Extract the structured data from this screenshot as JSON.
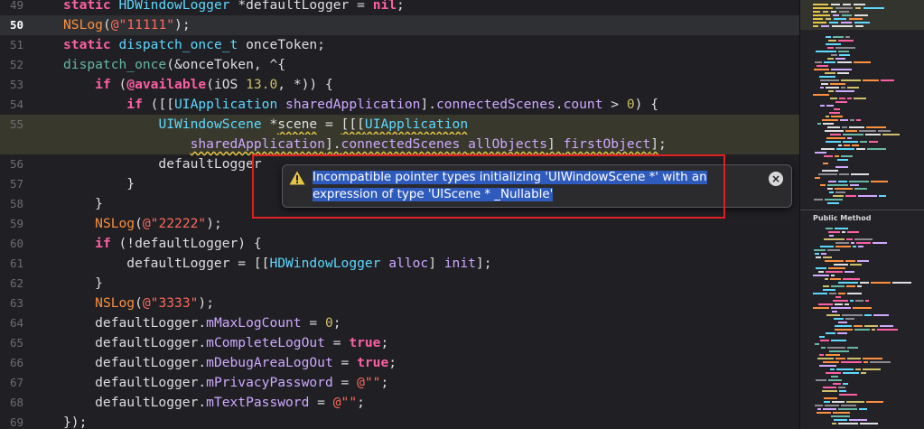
{
  "editor": {
    "lines": [
      {
        "no": "49",
        "segs": [
          [
            "kw",
            "static "
          ],
          [
            "ty",
            "HDWindowLogger "
          ],
          [
            "pl",
            "*defaultLogger = "
          ],
          [
            "kw",
            "nil"
          ],
          [
            "pl",
            ";"
          ]
        ]
      },
      {
        "no": "50",
        "current": true,
        "segs": [
          [
            "mac",
            "NSLog"
          ],
          [
            "pl",
            "("
          ],
          [
            "str",
            "@\"11111\""
          ],
          [
            "pl",
            ");"
          ]
        ]
      },
      {
        "no": "51",
        "segs": [
          [
            "kw",
            "static "
          ],
          [
            "ty",
            "dispatch_once_t "
          ],
          [
            "pl",
            "onceToken;"
          ]
        ]
      },
      {
        "no": "52",
        "segs": [
          [
            "fn",
            "dispatch_once"
          ],
          [
            "pl",
            "(&onceToken, ^{"
          ]
        ]
      },
      {
        "no": "53",
        "segs": [
          [
            "pl",
            "    "
          ],
          [
            "kw",
            "if "
          ],
          [
            "pl",
            "("
          ],
          [
            "kw",
            "@available"
          ],
          [
            "pl",
            "(iOS "
          ],
          [
            "num",
            "13.0"
          ],
          [
            "pl",
            ", *)) {"
          ]
        ]
      },
      {
        "no": "54",
        "segs": [
          [
            "pl",
            "        "
          ],
          [
            "kw",
            "if "
          ],
          [
            "pl",
            "([["
          ],
          [
            "ty",
            "UIApplication "
          ],
          [
            "pt",
            "sharedApplication"
          ],
          [
            "pl",
            "]."
          ],
          [
            "pt",
            "connectedScenes"
          ],
          [
            "pl",
            "."
          ],
          [
            "pt",
            "count"
          ],
          [
            "pl",
            " > "
          ],
          [
            "num",
            "0"
          ],
          [
            "pl",
            ") {"
          ]
        ]
      },
      {
        "no": "55",
        "warn": true,
        "segs": [
          [
            "pl",
            "            "
          ],
          [
            "ty",
            "UIWindowScene "
          ],
          [
            "pl",
            "*"
          ],
          [
            "sq",
            "scene"
          ],
          [
            "pl",
            " = "
          ],
          [
            "sq",
            "[[["
          ],
          [
            "sqt",
            "UIApplication"
          ]
        ]
      },
      {
        "no": "",
        "warn": true,
        "segs": [
          [
            "pl",
            "                "
          ],
          [
            "sqp",
            "sharedApplication"
          ],
          [
            "sq",
            "]."
          ],
          [
            "sqp",
            "connectedScenes"
          ],
          [
            "sq",
            " "
          ],
          [
            "sqp",
            "allObjects"
          ],
          [
            "sq",
            "] "
          ],
          [
            "sqp",
            "firstObject"
          ],
          [
            "sq",
            "]"
          ],
          [
            "pl",
            ";"
          ]
        ]
      },
      {
        "no": "56",
        "segs": [
          [
            "pl",
            "            defaultLogger"
          ]
        ]
      },
      {
        "no": "57",
        "segs": [
          [
            "pl",
            "        }"
          ]
        ]
      },
      {
        "no": "58",
        "segs": [
          [
            "pl",
            "    }"
          ]
        ]
      },
      {
        "no": "59",
        "segs": [
          [
            "pl",
            "    "
          ],
          [
            "mac",
            "NSLog"
          ],
          [
            "pl",
            "("
          ],
          [
            "str",
            "@\"22222\""
          ],
          [
            "pl",
            ");"
          ]
        ]
      },
      {
        "no": "60",
        "segs": [
          [
            "pl",
            "    "
          ],
          [
            "kw",
            "if "
          ],
          [
            "pl",
            "(!defaultLogger) {"
          ]
        ]
      },
      {
        "no": "61",
        "segs": [
          [
            "pl",
            "        defaultLogger = [["
          ],
          [
            "ty",
            "HDWindowLogger "
          ],
          [
            "pt",
            "alloc"
          ],
          [
            "pl",
            "] "
          ],
          [
            "pt",
            "init"
          ],
          [
            "pl",
            "];"
          ]
        ]
      },
      {
        "no": "62",
        "segs": [
          [
            "pl",
            "    }"
          ]
        ]
      },
      {
        "no": "63",
        "segs": [
          [
            "pl",
            "    "
          ],
          [
            "mac",
            "NSLog"
          ],
          [
            "pl",
            "("
          ],
          [
            "str",
            "@\"3333\""
          ],
          [
            "pl",
            ");"
          ]
        ]
      },
      {
        "no": "64",
        "segs": [
          [
            "pl",
            "    defaultLogger."
          ],
          [
            "pt",
            "mMaxLogCount"
          ],
          [
            "pl",
            " = "
          ],
          [
            "num",
            "0"
          ],
          [
            "pl",
            ";"
          ]
        ]
      },
      {
        "no": "65",
        "segs": [
          [
            "pl",
            "    defaultLogger."
          ],
          [
            "pt",
            "mCompleteLogOut"
          ],
          [
            "pl",
            " = "
          ],
          [
            "kw",
            "true"
          ],
          [
            "pl",
            ";"
          ]
        ]
      },
      {
        "no": "66",
        "segs": [
          [
            "pl",
            "    defaultLogger."
          ],
          [
            "pt",
            "mDebugAreaLogOut"
          ],
          [
            "pl",
            " = "
          ],
          [
            "kw",
            "true"
          ],
          [
            "pl",
            ";"
          ]
        ]
      },
      {
        "no": "67",
        "segs": [
          [
            "pl",
            "    defaultLogger."
          ],
          [
            "pt",
            "mPrivacyPassword"
          ],
          [
            "pl",
            " = "
          ],
          [
            "str",
            "@\"\""
          ],
          [
            "pl",
            ";"
          ]
        ]
      },
      {
        "no": "68",
        "segs": [
          [
            "pl",
            "    defaultLogger."
          ],
          [
            "pt",
            "mTextPassword"
          ],
          [
            "pl",
            " = "
          ],
          [
            "str",
            "@\"\""
          ],
          [
            "pl",
            ";"
          ]
        ]
      },
      {
        "no": "69",
        "segs": [
          [
            "pl",
            "});"
          ]
        ]
      }
    ]
  },
  "warning": {
    "line1": "Incompatible pointer types initializing 'UIWindowScene *' with an",
    "line2": "expression of type 'UIScene * _Nullable'",
    "close_glyph": "×",
    "icon_color": "#e5c547"
  },
  "minimap": {
    "section_label": "Public Method"
  },
  "colors": {
    "keyword": "#fc5fa3",
    "type": "#5dd8ff",
    "property": "#d0a8ff",
    "string": "#fc6a5d",
    "number": "#d0bf69",
    "macro": "#fd8f3f",
    "annotation_box": "#e02020"
  }
}
